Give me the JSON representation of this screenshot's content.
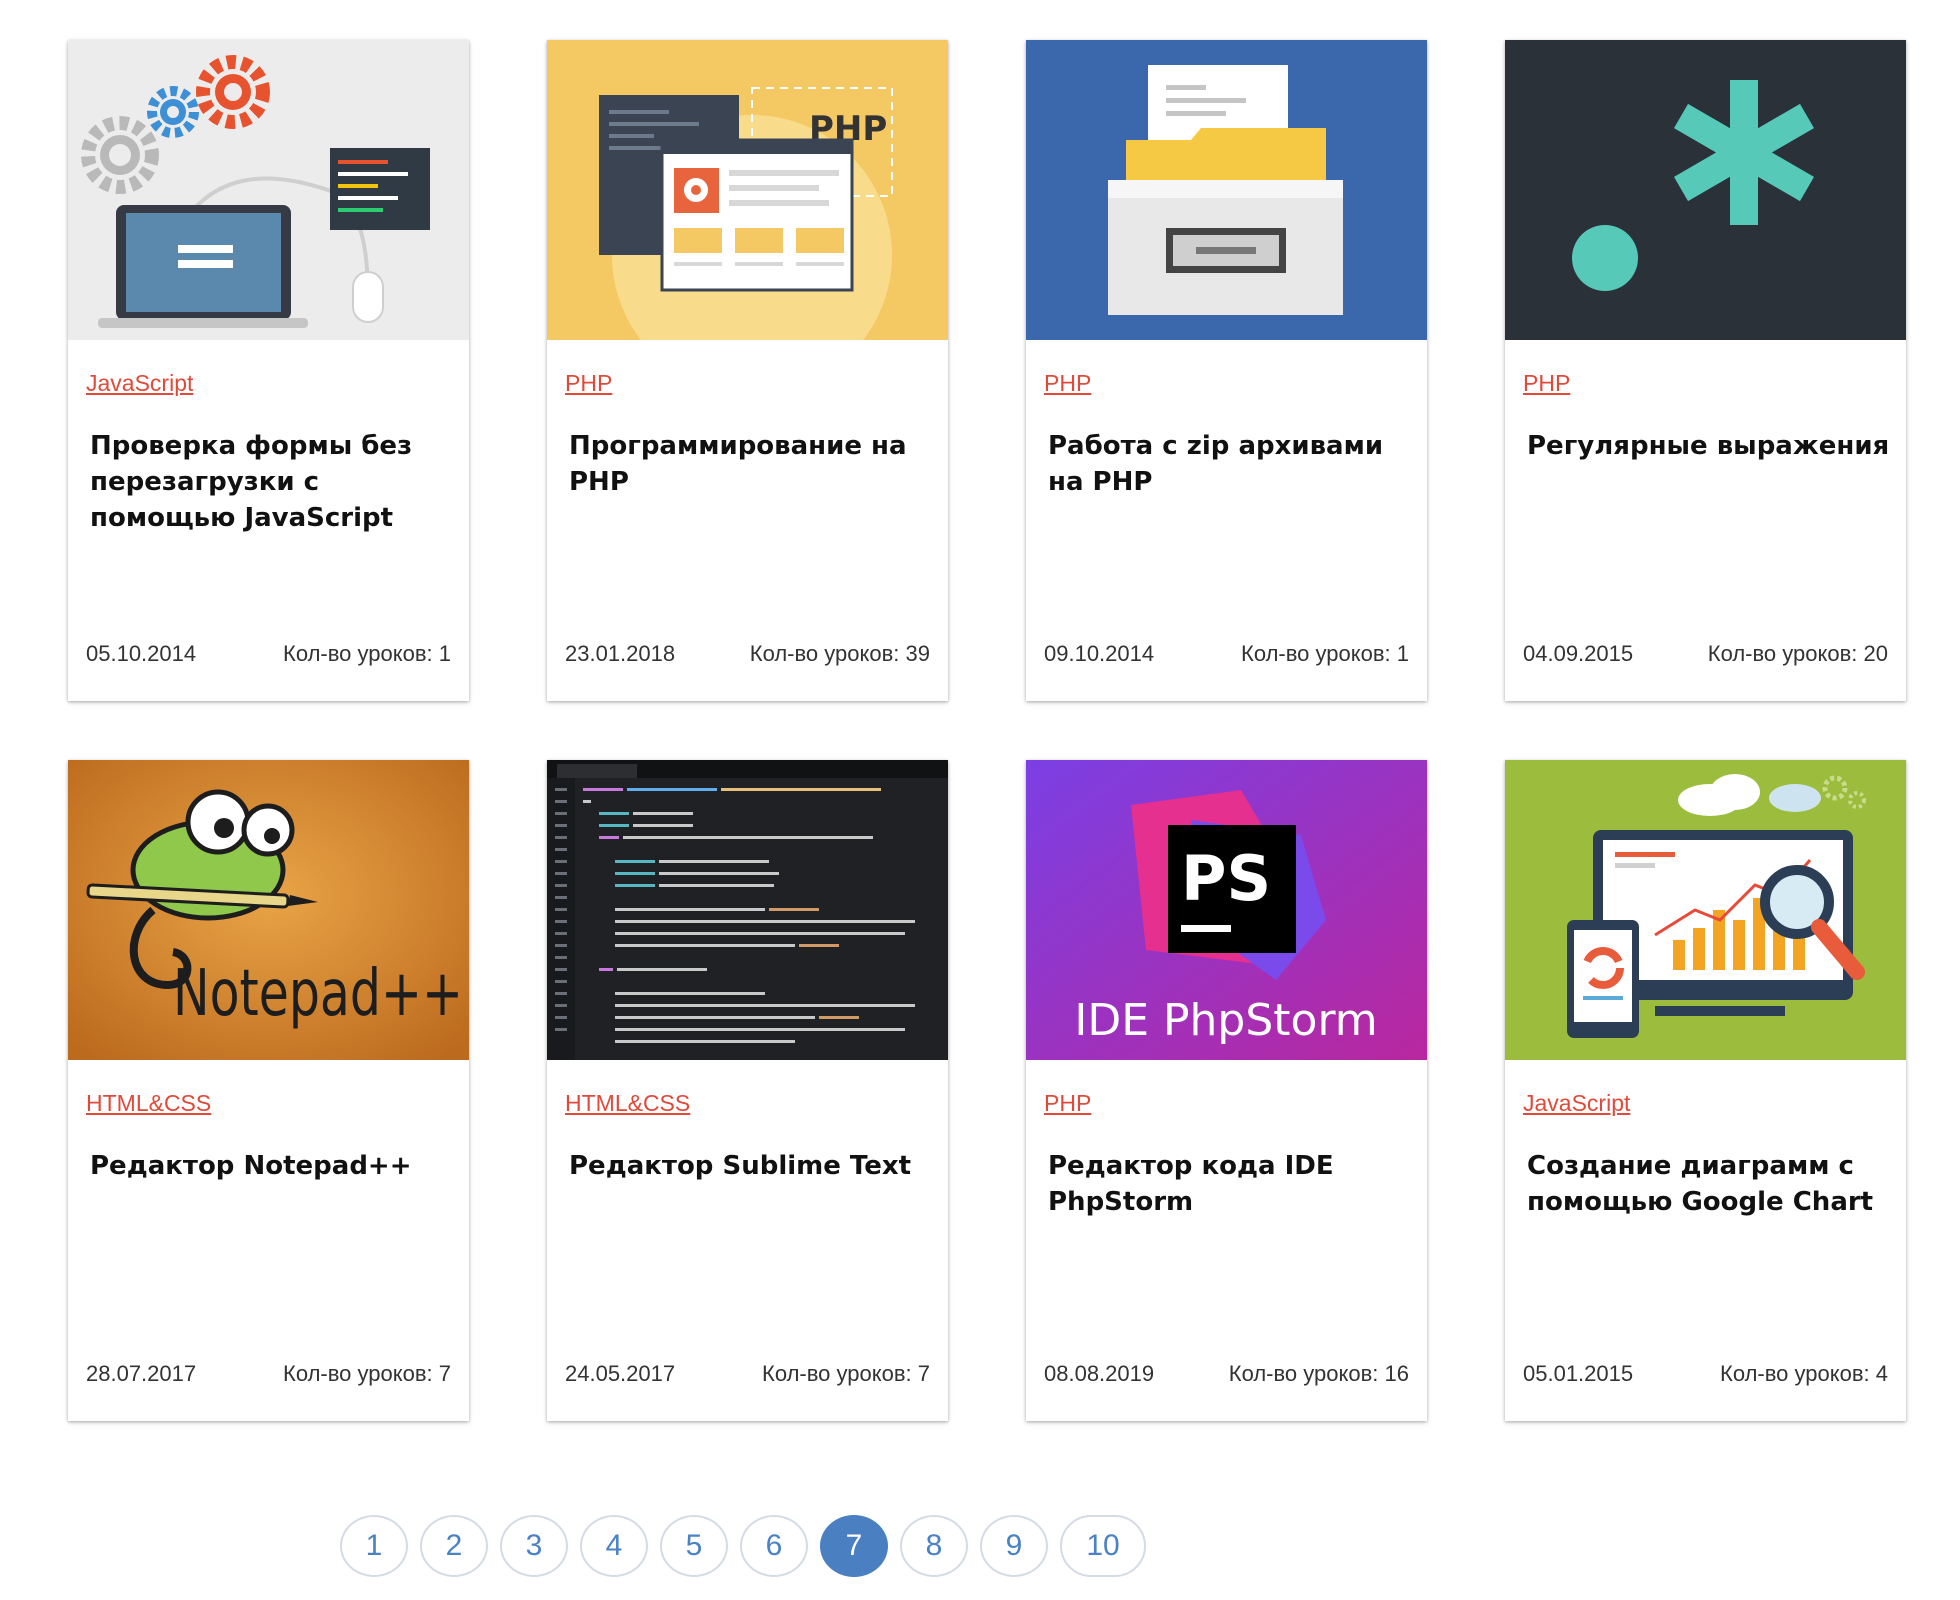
{
  "courses": [
    {
      "category": "JavaScript",
      "title": "Проверка формы без перезагрузки с помощью JavaScript",
      "date": "05.10.2014",
      "lessons": "Кол-во уроков: 1"
    },
    {
      "category": "PHP",
      "title": "Программирование на PHP",
      "date": "23.01.2018",
      "lessons": "Кол-во уроков: 39",
      "image_text": "PHP"
    },
    {
      "category": "PHP",
      "title": "Работа с zip архивами на PHP",
      "date": "09.10.2014",
      "lessons": "Кол-во уроков: 1"
    },
    {
      "category": "PHP",
      "title": "Регулярные выражения",
      "date": "04.09.2015",
      "lessons": "Кол-во уроков: 20"
    },
    {
      "category": "HTML&CSS",
      "title": "Редактор Notepad++",
      "date": "28.07.2017",
      "lessons": "Кол-во уроков: 7",
      "image_text": "Notepad++"
    },
    {
      "category": "HTML&CSS",
      "title": "Редактор Sublime Text",
      "date": "24.05.2017",
      "lessons": "Кол-во уроков: 7"
    },
    {
      "category": "PHP",
      "title": "Редактор кода IDE PhpStorm",
      "date": "08.08.2019",
      "lessons": "Кол-во уроков: 16",
      "image_text": "IDE PhpStorm",
      "logo_text": "PS"
    },
    {
      "category": "JavaScript",
      "title": "Создание диаграмм с помощью Google Chart",
      "date": "05.01.2015",
      "lessons": "Кол-во уроков: 4"
    }
  ],
  "pagination": {
    "pages": [
      "1",
      "2",
      "3",
      "4",
      "5",
      "6",
      "7",
      "8",
      "9",
      "10"
    ],
    "current": "7"
  },
  "colors": {
    "category_link": "#e04a3a",
    "pagination_active": "#4a7fc1",
    "pagination_text": "#4a82c4"
  }
}
